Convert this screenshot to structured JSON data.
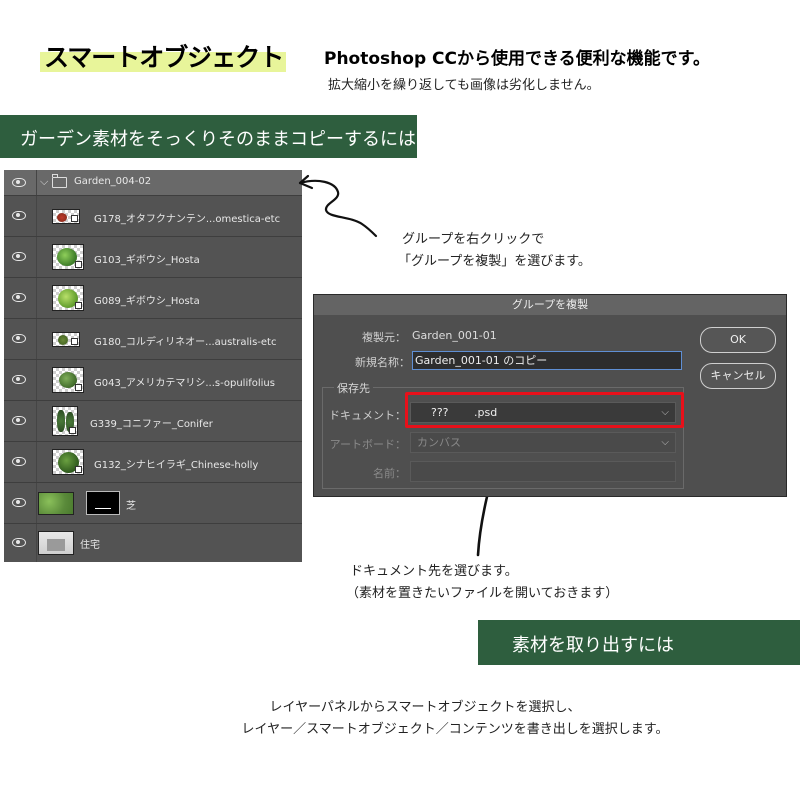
{
  "header": {
    "title": "スマートオブジェクト",
    "headline": "Photoshop CCから使用できる便利な機能です。",
    "subline": "拡大縮小を繰り返しても画像は劣化しません。"
  },
  "banners": {
    "copy": "ガーデン素材をそっくりそのままコピーするには",
    "extract": "素材を取り出すには"
  },
  "layers": {
    "group_name": "Garden_004-02",
    "items": [
      {
        "name": "G178_オタフクナンテン...omestica-etc"
      },
      {
        "name": "G103_ギボウシ_Hosta"
      },
      {
        "name": "G089_ギボウシ_Hosta"
      },
      {
        "name": "G180_コルディリネオー...australis-etc"
      },
      {
        "name": "G043_アメリカテマリシ...s-opulifolius"
      },
      {
        "name": "G339_コニファー_Conifer"
      },
      {
        "name": "G132_シナヒイラギ_Chinese-holly"
      },
      {
        "name": "芝"
      },
      {
        "name": "住宅"
      }
    ]
  },
  "dialog": {
    "title": "グループを複製",
    "source_label": "複製元：",
    "source_value": "Garden_001-01",
    "newname_label": "新規名称：",
    "newname_value": "Garden_001-01 のコピー",
    "destination_legend": "保存先",
    "document_label": "ドキュメント：",
    "document_value": "???　　 .psd",
    "artboard_label": "アートボード：",
    "artboard_value": "カンバス",
    "name_label": "名前：",
    "name_value": "",
    "ok_label": "OK",
    "cancel_label": "キャンセル"
  },
  "notes": {
    "group_line1": "グループを右クリックで",
    "group_line2": "「グループを複製」を選びます。",
    "doc_line1": "ドキュメント先を選びます。",
    "doc_line2": "（素材を置きたいファイルを開いておきます）",
    "extract_line1": "レイヤーパネルからスマートオブジェクトを選択し、",
    "extract_line2": "レイヤー／スマートオブジェクト／コンテンツを書き出しを選択します。"
  },
  "colors": {
    "banner": "#2e5e3e",
    "highlight": "#e8f59a",
    "panel": "#535353",
    "red_box": "#e8101a"
  }
}
